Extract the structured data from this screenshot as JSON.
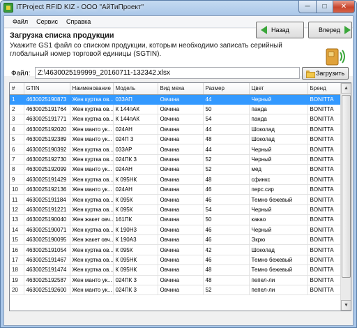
{
  "window": {
    "title": "ITProject RFID KIZ - ООО \"АйТиПроект\"",
    "minimize_glyph": "─",
    "maximize_glyph": "□",
    "close_glyph": "✕"
  },
  "menu": {
    "items": [
      {
        "label": "Файл"
      },
      {
        "label": "Сервис"
      },
      {
        "label": "Справка"
      }
    ]
  },
  "header": {
    "title": "Загрузка списка продукции",
    "description": "Укажите GS1 файл со списком продукции, которым необходимо записать серийный глобальный номер торговой единицы (SGTIN).",
    "icon": "rfid-card-icon"
  },
  "file": {
    "label": "Файл:",
    "path": "Z:\\4630025199999_20160711-132342.xlsx",
    "load_button": "Загрузить",
    "load_icon": "folder-icon"
  },
  "table": {
    "columns": [
      "#",
      "GTIN",
      "Наименование",
      "Модель",
      "Вид меха",
      "Размер",
      "Цвет",
      "Бренд"
    ],
    "selected_row": 0,
    "rows": [
      [
        "1",
        "4630025190873",
        "Жен куртка ов...",
        "033АП",
        "Овчина",
        "44",
        "Черный",
        "BONITTA"
      ],
      [
        "2",
        "4630025191764",
        "Жен куртка ов...",
        "К 144пАК",
        "Овчина",
        "50",
        "панда",
        "BONITTA"
      ],
      [
        "3",
        "4630025191771",
        "Жен куртка ов...",
        "К 144пАК",
        "Овчина",
        "54",
        "панда",
        "BONITTA"
      ],
      [
        "4",
        "4630025192020",
        "Жен манто ук...",
        "024АН",
        "Овчина",
        "44",
        "Шоколад",
        "BONITTA"
      ],
      [
        "5",
        "4630025192389",
        "Жен манто ук...",
        "024П 3",
        "Овчина",
        "48",
        "Шоколад",
        "BONITTA"
      ],
      [
        "6",
        "4630025190392",
        "Жен куртка ов...",
        "033АР",
        "Овчина",
        "44",
        "Черный",
        "BONITTA"
      ],
      [
        "7",
        "4630025192730",
        "Жен куртка ов...",
        "024ПК 3",
        "Овчина",
        "52",
        "Черный",
        "BONITTA"
      ],
      [
        "8",
        "4630025192099",
        "Жен манто ук...",
        "024АН",
        "Овчина",
        "52",
        "мед",
        "BONITTA"
      ],
      [
        "9",
        "4630025191429",
        "Жен куртка ов...",
        "К 095НК",
        "Овчина",
        "48",
        "сфинкс",
        "BONITTA"
      ],
      [
        "10",
        "4630025192136",
        "Жен манто ук...",
        "024АН",
        "Овчина",
        "46",
        "перс.сир",
        "BONITTA"
      ],
      [
        "11",
        "4630025191184",
        "Жен куртка ов...",
        "К 095К",
        "Овчина",
        "46",
        "Темно бежевый",
        "BONITTA"
      ],
      [
        "12",
        "4630025191221",
        "Жен куртка ов...",
        "К 095К",
        "Овчина",
        "54",
        "Черный",
        "BONITTA"
      ],
      [
        "13",
        "4630025190040",
        "Жен жакет овч...",
        "161ПК",
        "Овчина",
        "50",
        "какао",
        "BONITTA"
      ],
      [
        "14",
        "4630025190071",
        "Жен куртка ов...",
        "К 190Н3",
        "Овчина",
        "46",
        "Черный",
        "BONITTA"
      ],
      [
        "15",
        "4630025190095",
        "Жен жакет овч...",
        "К 190А3",
        "Овчина",
        "46",
        "Экрю",
        "BONITTA"
      ],
      [
        "16",
        "4630025191054",
        "Жен куртка ов...",
        "К 095К",
        "Овчина",
        "42",
        "Шоколад",
        "BONITTA"
      ],
      [
        "17",
        "4630025191467",
        "Жен куртка ов...",
        "К 095НК",
        "Овчина",
        "46",
        "Темно бежевый",
        "BONITTA"
      ],
      [
        "18",
        "4630025191474",
        "Жен куртка ов...",
        "К 095НК",
        "Овчина",
        "48",
        "Темно бежевый",
        "BONITTA"
      ],
      [
        "19",
        "4630025192587",
        "Жен манто ук...",
        "024ПК 3",
        "Овчина",
        "48",
        "пепел-ли",
        "BONITTA"
      ],
      [
        "20",
        "4630025192600",
        "Жен манто ук...",
        "024ПК 3",
        "Овчина",
        "52",
        "пепел-ли",
        "BONITTA"
      ]
    ]
  },
  "footer": {
    "back_label": "Назад",
    "next_label": "Вперед"
  },
  "colors": {
    "selection": "#3399ff",
    "nav_arrow": "#3aa63a",
    "close_button": "#c8452c"
  }
}
